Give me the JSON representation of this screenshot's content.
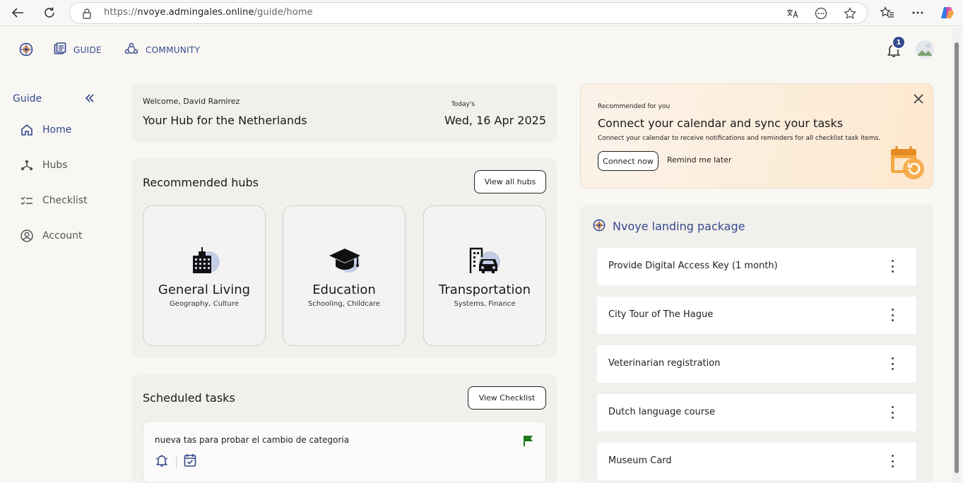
{
  "browser": {
    "url_prefix": "https://",
    "url_host": "nvoye.admingales.online",
    "url_path": "/guide/home"
  },
  "topnav": {
    "guide_label": "GUIDE",
    "community_label": "COMMUNITY",
    "notification_count": "1"
  },
  "sidebar": {
    "title": "Guide",
    "items": [
      {
        "label": "Home"
      },
      {
        "label": "Hubs"
      },
      {
        "label": "Checklist"
      },
      {
        "label": "Account"
      }
    ]
  },
  "welcome": {
    "greeting": "Welcome, David Ramirez",
    "title": "Your Hub for the Netherlands",
    "today_label": "Today's",
    "date": "Wed, 16 Apr 2025"
  },
  "hubs": {
    "title": "Recommended hubs",
    "view_all_label": "View all hubs",
    "items": [
      {
        "name": "General Living",
        "desc": "Geography, Culture",
        "icon": "building-icon"
      },
      {
        "name": "Education",
        "desc": "Schooling, Childcare",
        "icon": "graduation-cap-icon"
      },
      {
        "name": "Transportation",
        "desc": "Systems, Finance",
        "icon": "car-city-icon"
      }
    ]
  },
  "tasks": {
    "title": "Scheduled tasks",
    "view_checklist_label": "View Checklist",
    "items": [
      {
        "text": "nueva tas para probar el cambio de categoria"
      }
    ]
  },
  "recommendation": {
    "small": "Recommended for you",
    "title": "Connect your calendar and sync your tasks",
    "desc": "Connect your calendar to receive notifications and reminders for all checklist task items.",
    "connect_label": "Connect now",
    "remind_label": "Remind me later"
  },
  "package": {
    "title": "Nvoye landing package",
    "items": [
      {
        "label": "Provide Digital Access Key (1 month)"
      },
      {
        "label": "City Tour of The Hague"
      },
      {
        "label": "Veterinarian registration"
      },
      {
        "label": "Dutch language course"
      },
      {
        "label": "Museum Card"
      }
    ]
  },
  "colors": {
    "brand": "#33488c",
    "flag": "#1a7a1a",
    "accent_orange": "#f5a742"
  }
}
